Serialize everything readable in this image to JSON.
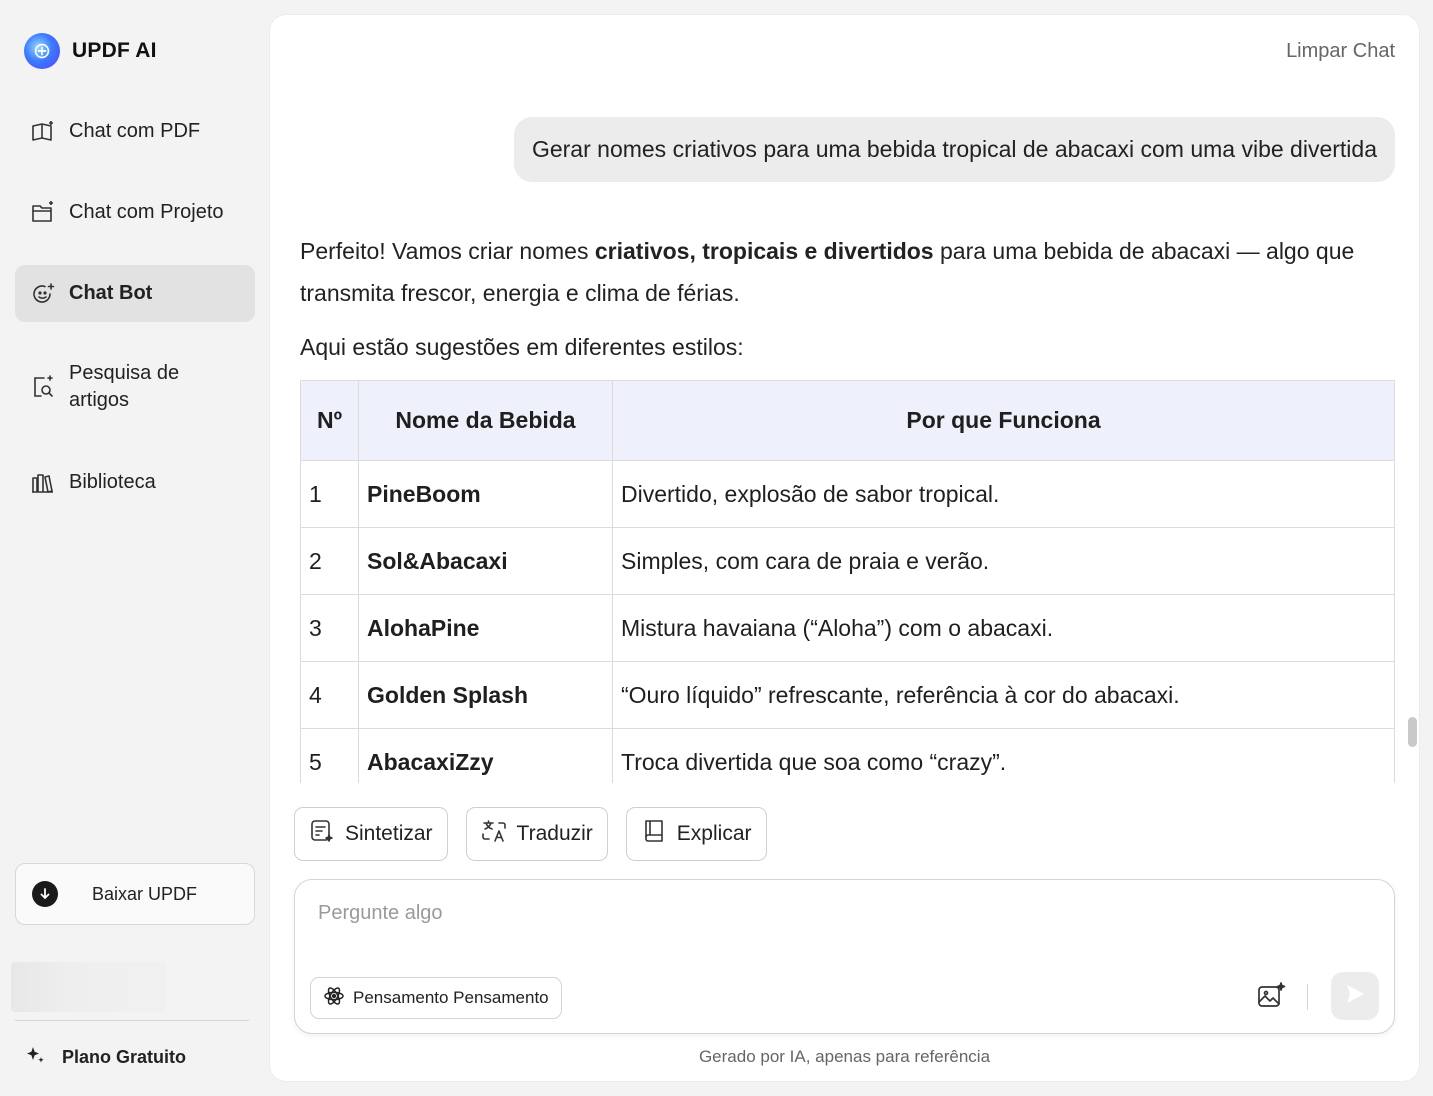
{
  "app": {
    "name": "UPDF AI"
  },
  "sidebar": {
    "items": [
      {
        "label": "Chat com PDF",
        "icon": "book-sparkle-icon"
      },
      {
        "label": "Chat com Projeto",
        "icon": "folder-sparkle-icon"
      },
      {
        "label": "Chat Bot",
        "icon": "bot-face-icon",
        "active": true
      },
      {
        "label": "Pesquisa de artigos",
        "icon": "doc-search-icon"
      },
      {
        "label": "Biblioteca",
        "icon": "library-icon"
      }
    ],
    "download_label": "Baixar UPDF",
    "plan_label": "Plano Gratuito"
  },
  "header": {
    "clear_chat": "Limpar Chat"
  },
  "chat": {
    "user_message": "Gerar nomes criativos para uma bebida tropical de abacaxi com uma vibe divertida",
    "answer": {
      "intro_pre": "Perfeito! Vamos criar nomes ",
      "intro_bold": "criativos, tropicais e divertidos",
      "intro_post": " para uma bebida de abacaxi — algo que transmita frescor, energia e clima de férias.",
      "p2": "Aqui estão sugestões em diferentes estilos:"
    },
    "table": {
      "headers": [
        "Nº",
        "Nome da Bebida",
        "Por que Funciona"
      ],
      "rows": [
        {
          "n": "1",
          "name": "PineBoom",
          "why": "Divertido, explosão de sabor tropical."
        },
        {
          "n": "2",
          "name": "Sol&Abacaxi",
          "why": "Simples, com cara de praia e verão."
        },
        {
          "n": "3",
          "name": "AlohaPine",
          "why": "Mistura havaiana (“Aloha”) com o abacaxi."
        },
        {
          "n": "4",
          "name": "Golden Splash",
          "why": "“Ouro líquido” refrescante, referência à cor do abacaxi."
        },
        {
          "n": "5",
          "name": "AbacaxiZzy",
          "why": "Troca divertida que soa como “crazy”."
        }
      ]
    }
  },
  "quick_actions": [
    {
      "label": "Sintetizar",
      "icon": "summarize-icon"
    },
    {
      "label": "Traduzir",
      "icon": "translate-icon"
    },
    {
      "label": "Explicar",
      "icon": "book-icon"
    }
  ],
  "input": {
    "placeholder": "Pergunte algo",
    "think_label": "Pensamento Pensamento"
  },
  "footer_note": "Gerado por IA, apenas para referência",
  "colors": {
    "table_header_bg": "#eef0fc",
    "active_nav_bg": "#e2e2e2",
    "page_bg": "#f3f3f3"
  }
}
